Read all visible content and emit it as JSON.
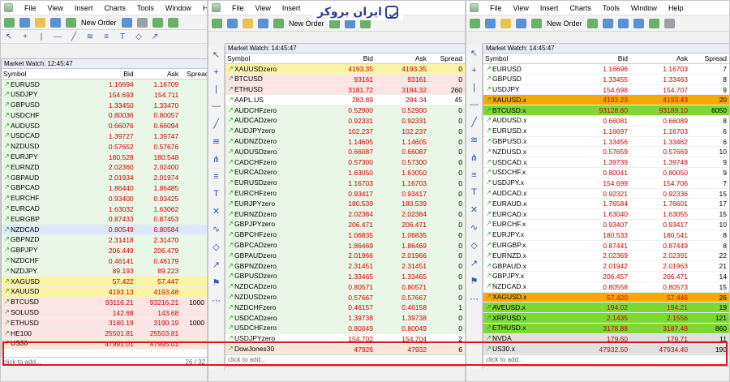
{
  "brand": {
    "text": "ایران بروکر"
  },
  "t1": {
    "menu": [
      "File",
      "View",
      "Insert",
      "Charts",
      "Tools",
      "Window",
      "He"
    ],
    "new_order": "New Order",
    "mw_title": "Market Watch: 12:45:47",
    "headers": [
      "Symbol",
      "Bid",
      "Ask",
      "Spread"
    ],
    "rows": [
      {
        "s": "EURUSD",
        "b": "1.16694",
        "a": "1.16709",
        "d": "up",
        "bg": "green"
      },
      {
        "s": "USDJPY",
        "b": "154.693",
        "a": "154.711",
        "d": "up",
        "bg": "green"
      },
      {
        "s": "GBPUSD",
        "b": "1.33450",
        "a": "1.33470",
        "d": "up",
        "bg": "green"
      },
      {
        "s": "USDCHF",
        "b": "0.80036",
        "a": "0.80057",
        "d": "up",
        "bg": "green"
      },
      {
        "s": "AUDUSD",
        "b": "0.66076",
        "a": "0.66094",
        "d": "up",
        "bg": "green"
      },
      {
        "s": "USDCAD",
        "b": "1.39727",
        "a": "1.39747",
        "d": "up",
        "bg": "green"
      },
      {
        "s": "NZDUSD",
        "b": "0.57652",
        "a": "0.57676",
        "d": "up",
        "bg": "green"
      },
      {
        "s": "EURJPY",
        "b": "180.528",
        "a": "180.548",
        "d": "up",
        "bg": "green"
      },
      {
        "s": "EURNZD",
        "b": "2.02360",
        "a": "2.02400",
        "d": "up",
        "bg": "green"
      },
      {
        "s": "GBPAUD",
        "b": "2.01934",
        "a": "2.01974",
        "d": "up",
        "bg": "green"
      },
      {
        "s": "GBPCAD",
        "b": "1.86440",
        "a": "1.86485",
        "d": "up",
        "bg": "green"
      },
      {
        "s": "EURCHF",
        "b": "0.93400",
        "a": "0.93425",
        "d": "up",
        "bg": "green"
      },
      {
        "s": "EURCAD",
        "b": "1.63032",
        "a": "1.63062",
        "d": "up",
        "bg": "green"
      },
      {
        "s": "EURGBP",
        "b": "0.87433",
        "a": "0.87453",
        "d": "up",
        "bg": "green"
      },
      {
        "s": "NZDCAD",
        "b": "0.80549",
        "a": "0.80584",
        "d": "up",
        "bg": "blue"
      },
      {
        "s": "GBPNZD",
        "b": "2.31418",
        "a": "2.31470",
        "d": "up",
        "bg": "green"
      },
      {
        "s": "GBPJPY",
        "b": "206.449",
        "a": "206.479",
        "d": "up",
        "bg": "green"
      },
      {
        "s": "NZDCHF",
        "b": "0.46141",
        "a": "0.46179",
        "d": "up",
        "bg": "green"
      },
      {
        "s": "NZDJPY",
        "b": "89.193",
        "a": "89.223",
        "d": "up",
        "bg": "green"
      },
      {
        "s": "XAGUSD",
        "b": "57.422",
        "a": "57.447",
        "d": "up",
        "bg": "yellow"
      },
      {
        "s": "XAUUSD",
        "b": "4193.13",
        "a": "4193.48",
        "d": "up",
        "bg": "yellow"
      },
      {
        "s": "BTCUSD",
        "b": "93116.21",
        "a": "93216.21",
        "sp": "1000",
        "d": "up",
        "bg": "pink"
      },
      {
        "s": "SOLUSD",
        "b": "142.68",
        "a": "143.68",
        "d": "up",
        "bg": "pink"
      },
      {
        "s": "ETHUSD",
        "b": "3180.19",
        "a": "3190.19",
        "sp": "1000",
        "d": "up",
        "bg": "pink"
      },
      {
        "s": "HE100",
        "b": "25501.81",
        "a": "25503.81",
        "d": "up",
        "bg": "pink"
      },
      {
        "s": "US30",
        "b": "47991.01",
        "a": "47995.01",
        "d": "up",
        "bg": "peach"
      }
    ],
    "click": "click to add...",
    "count": "26 / 32"
  },
  "t2": {
    "menu": [
      "File",
      "View",
      "Insert"
    ],
    "new_order": "New Order",
    "mw_title": "Market Watch: 14:45:47",
    "headers": [
      "Symbol",
      "Bid",
      "Ask",
      "Spread"
    ],
    "rows": [
      {
        "s": "XAUUSDzero",
        "b": "4193.35",
        "a": "4193.35",
        "sp": "0",
        "d": "up",
        "bg": "yellow"
      },
      {
        "s": "BTCUSD",
        "b": "93161",
        "a": "93161",
        "sp": "0",
        "d": "up",
        "bg": "pink"
      },
      {
        "s": "ETHUSD",
        "b": "3181.72",
        "a": "3184.32",
        "sp": "260",
        "d": "up",
        "bg": "pink"
      },
      {
        "s": "AAPL.US",
        "b": "283.89",
        "a": "284.34",
        "sp": "45",
        "d": "up",
        "bg": "white"
      },
      {
        "s": "AUDCHFzero",
        "b": "0.52900",
        "a": "0.52900",
        "sp": "0",
        "d": "up",
        "bg": "green"
      },
      {
        "s": "AUDCADzero",
        "b": "0.92331",
        "a": "0.92331",
        "sp": "0",
        "d": "up",
        "bg": "green"
      },
      {
        "s": "AUDJPYzero",
        "b": "102.237",
        "a": "102.237",
        "sp": "0",
        "d": "up",
        "bg": "green"
      },
      {
        "s": "AUDNZDzero",
        "b": "1.14605",
        "a": "1.14605",
        "sp": "0",
        "d": "up",
        "bg": "green"
      },
      {
        "s": "AUDUSDzero",
        "b": "0.66087",
        "a": "0.66087",
        "sp": "0",
        "d": "up",
        "bg": "green"
      },
      {
        "s": "CADCHFzero",
        "b": "0.57300",
        "a": "0.57300",
        "sp": "0",
        "d": "up",
        "bg": "green"
      },
      {
        "s": "EURCADzero",
        "b": "1.63050",
        "a": "1.63050",
        "sp": "0",
        "d": "up",
        "bg": "green"
      },
      {
        "s": "EURUSDzero",
        "b": "1.16703",
        "a": "1.16703",
        "sp": "0",
        "d": "up",
        "bg": "green"
      },
      {
        "s": "EURCHFzero",
        "b": "0.93417",
        "a": "0.93417",
        "sp": "0",
        "d": "up",
        "bg": "green"
      },
      {
        "s": "EURJPYzero",
        "b": "180.539",
        "a": "180.539",
        "sp": "0",
        "d": "up",
        "bg": "green"
      },
      {
        "s": "EURNZDzero",
        "b": "2.02384",
        "a": "2.02384",
        "sp": "0",
        "d": "up",
        "bg": "green"
      },
      {
        "s": "GBPJPYzero",
        "b": "206.471",
        "a": "206.471",
        "sp": "0",
        "d": "up",
        "bg": "green"
      },
      {
        "s": "GBPCHFzero",
        "b": "1.06835",
        "a": "1.06835",
        "sp": "0",
        "d": "up",
        "bg": "green"
      },
      {
        "s": "GBPCADzero",
        "b": "1.86469",
        "a": "1.86469",
        "sp": "0",
        "d": "up",
        "bg": "green"
      },
      {
        "s": "GBPAUDzero",
        "b": "2.01966",
        "a": "2.01966",
        "sp": "0",
        "d": "up",
        "bg": "green"
      },
      {
        "s": "GBPNZDzero",
        "b": "2.31451",
        "a": "2.31451",
        "sp": "0",
        "d": "up",
        "bg": "green"
      },
      {
        "s": "GBPUSDzero",
        "b": "1.33465",
        "a": "1.33465",
        "sp": "0",
        "d": "up",
        "bg": "green"
      },
      {
        "s": "NZDCADzero",
        "b": "0.80571",
        "a": "0.80571",
        "sp": "0",
        "d": "up",
        "bg": "green"
      },
      {
        "s": "NZDUSDzero",
        "b": "0.57667",
        "a": "0.57667",
        "sp": "0",
        "d": "up",
        "bg": "green"
      },
      {
        "s": "NZDCHFzero",
        "b": "0.46157",
        "a": "0.46158",
        "sp": "1",
        "d": "up",
        "bg": "green"
      },
      {
        "s": "USDCADzero",
        "b": "1.39738",
        "a": "1.39738",
        "sp": "0",
        "d": "up",
        "bg": "green"
      },
      {
        "s": "USDCHFzero",
        "b": "0.80049",
        "a": "0.80049",
        "sp": "0",
        "d": "up",
        "bg": "green"
      },
      {
        "s": "USDJPYzero",
        "b": "154.702",
        "a": "154.704",
        "sp": "2",
        "d": "up",
        "bg": "white"
      },
      {
        "s": "DowJones30",
        "b": "47926",
        "a": "47932",
        "sp": "6",
        "d": "up",
        "bg": "peach"
      }
    ],
    "click": "click to add..."
  },
  "t3": {
    "menu": [
      "File",
      "View",
      "Insert",
      "Charts",
      "Tools",
      "Window",
      "Help"
    ],
    "new_order": "New Order",
    "mw_title": "Market Watch: 14:45:47",
    "headers": [
      "Symbol",
      "Bid",
      "Ask",
      "Spread"
    ],
    "rows": [
      {
        "s": "EURUSD",
        "b": "1.16696",
        "a": "1.16703",
        "sp": "7",
        "d": "up",
        "bg": "white"
      },
      {
        "s": "GBPUSD",
        "b": "1.33455",
        "a": "1.33463",
        "sp": "8",
        "d": "up",
        "bg": "white"
      },
      {
        "s": "USDJPY",
        "b": "154.698",
        "a": "154.707",
        "sp": "9",
        "d": "up",
        "bg": "white"
      },
      {
        "s": "XAUUSD.x",
        "b": "4193.23",
        "a": "4193.43",
        "sp": "20",
        "d": "up",
        "bg": "orange"
      },
      {
        "s": "BTCUSD.x",
        "b": "93128.60",
        "a": "93189.10",
        "sp": "6050",
        "d": "up",
        "bg": "lime"
      },
      {
        "s": "AUDUSD.x",
        "b": "0.66081",
        "a": "0.66089",
        "sp": "8",
        "d": "up",
        "bg": "white"
      },
      {
        "s": "EURUSD.x",
        "b": "1.16697",
        "a": "1.16703",
        "sp": "6",
        "d": "up",
        "bg": "white"
      },
      {
        "s": "GBPUSD.x",
        "b": "1.33456",
        "a": "1.33462",
        "sp": "6",
        "d": "up",
        "bg": "white"
      },
      {
        "s": "NZDUSD.x",
        "b": "0.57659",
        "a": "0.57669",
        "sp": "10",
        "d": "up",
        "bg": "white"
      },
      {
        "s": "USDCAD.x",
        "b": "1.39739",
        "a": "1.39748",
        "sp": "9",
        "d": "up",
        "bg": "white"
      },
      {
        "s": "USDCHF.x",
        "b": "0.80041",
        "a": "0.80050",
        "sp": "9",
        "d": "up",
        "bg": "white"
      },
      {
        "s": "USDJPY.x",
        "b": "154.699",
        "a": "154.706",
        "sp": "7",
        "d": "up",
        "bg": "white"
      },
      {
        "s": "AUDCAD.x",
        "b": "0.92321",
        "a": "0.92336",
        "sp": "15",
        "d": "up",
        "bg": "white"
      },
      {
        "s": "EURAUD.x",
        "b": "1.76584",
        "a": "1.76601",
        "sp": "17",
        "d": "up",
        "bg": "white"
      },
      {
        "s": "EURCAD.x",
        "b": "1.63040",
        "a": "1.63055",
        "sp": "15",
        "d": "up",
        "bg": "white"
      },
      {
        "s": "EURCHF.x",
        "b": "0.93407",
        "a": "0.93417",
        "sp": "10",
        "d": "up",
        "bg": "white"
      },
      {
        "s": "EURJPY.x",
        "b": "180.533",
        "a": "180.541",
        "sp": "8",
        "d": "up",
        "bg": "white"
      },
      {
        "s": "EURGBP.x",
        "b": "0.87441",
        "a": "0.87449",
        "sp": "8",
        "d": "up",
        "bg": "white"
      },
      {
        "s": "EURNZD.x",
        "b": "2.02369",
        "a": "2.02391",
        "sp": "22",
        "d": "up",
        "bg": "white"
      },
      {
        "s": "GBPAUD.x",
        "b": "2.01942",
        "a": "2.01963",
        "sp": "21",
        "d": "up",
        "bg": "white"
      },
      {
        "s": "GBPJPY.x",
        "b": "206.457",
        "a": "206.471",
        "sp": "14",
        "d": "up",
        "bg": "white"
      },
      {
        "s": "NZDCAD.x",
        "b": "0.80558",
        "a": "0.80573",
        "sp": "15",
        "d": "up",
        "bg": "white"
      },
      {
        "s": "XAGUSD.x",
        "b": "57.420",
        "a": "57.446",
        "sp": "26",
        "d": "up",
        "bg": "orange"
      },
      {
        "s": "AVEUSD.x",
        "b": "194.02",
        "a": "194.21",
        "sp": "19",
        "d": "up",
        "bg": "lime"
      },
      {
        "s": "XRPUSD.x",
        "b": "2.1435",
        "a": "2.1556",
        "sp": "121",
        "d": "up",
        "bg": "lime"
      },
      {
        "s": "ETHUSD.x",
        "b": "3178.88",
        "a": "3187.48",
        "sp": "860",
        "d": "up",
        "bg": "lime"
      },
      {
        "s": "NVDA",
        "b": "179.60",
        "a": "179.71",
        "sp": "11",
        "d": "up",
        "bg": "gray"
      },
      {
        "s": "US30.x",
        "b": "47932.50",
        "a": "47934.40",
        "sp": "190",
        "d": "up",
        "bg": "gray"
      }
    ],
    "click": "click to add..."
  }
}
